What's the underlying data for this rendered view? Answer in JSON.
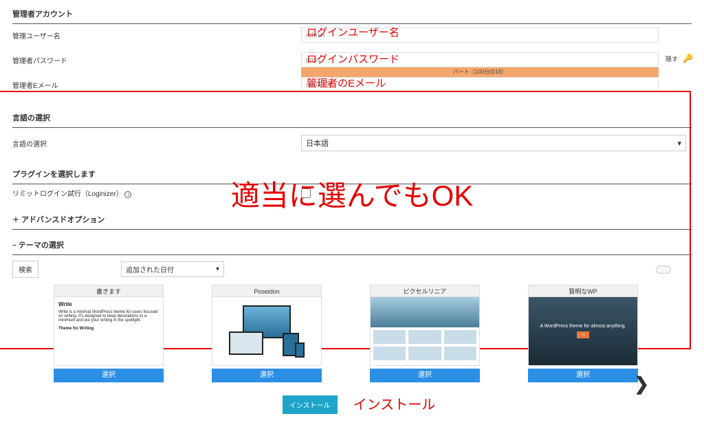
{
  "admin_account": {
    "header": "管理者アカウント",
    "username_label": "管理ユーザー名",
    "username_value": "admin",
    "username_annot": "ログインユーザー名",
    "password_label": "管理者パスワード",
    "password_value": "pass",
    "password_annot": "ログインパスワード",
    "password_strength": "バート（100分の18）",
    "password_hide": "隠す",
    "email_label": "管理者Eメール",
    "email_value": "admin@",
    "email_annot": "管理者のEメール"
  },
  "language": {
    "header": "言語の選択",
    "label": "言語の選択",
    "value": "日本語"
  },
  "plugins": {
    "header": "プラグインを選択します",
    "loginizer_label": "リミットログイン試行（Loginizer）"
  },
  "advanced": {
    "header": "アドバンスドオプション"
  },
  "themes": {
    "header": "テーマの選択",
    "search": "検索",
    "sort": "追加された日付",
    "items": [
      {
        "title": "書きます",
        "select": "選択"
      },
      {
        "title": "Poseidon",
        "select": "選択"
      },
      {
        "title": "ピクセルリニア",
        "select": "選択"
      },
      {
        "title": "賢明なWP",
        "select": "選択"
      }
    ],
    "wp_tagline": "A WordPress theme for almost anything."
  },
  "big_annot": "適当に選んでもOK",
  "install_btn": "インストール",
  "install_annot": "インストール",
  "icons": {
    "caret": "▾",
    "plus": "＋",
    "minus": "−",
    "info": "i",
    "chevron": "❯",
    "key": "🔑"
  },
  "thumb_write": {
    "heading": "Write",
    "line1": "Write is a minimal WordPress theme for users focused",
    "line2": "on writing. It's designed to keep decorations to a",
    "line3": "minimum and put your writing in the spotlight.",
    "sub": "Theme for Writing"
  }
}
